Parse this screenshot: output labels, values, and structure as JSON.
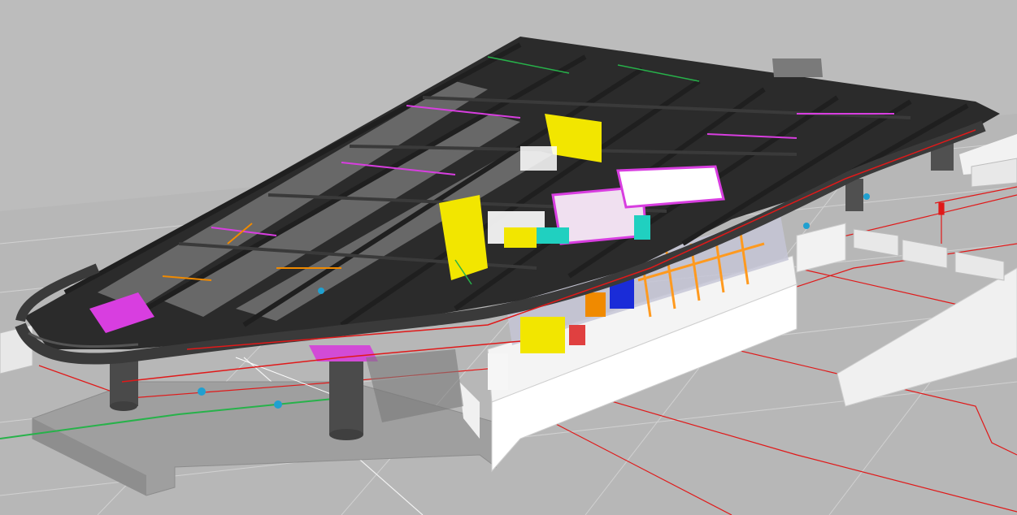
{
  "viewport": {
    "background": "#bdbdbd",
    "icon": "3d-model-viewport-icon"
  },
  "model": {
    "colors": {
      "ground": "#b4b4b4",
      "roof_frame": "#2b2b2b",
      "roof_edge": "#3a3a3a",
      "slab_shadow": "#9c9c9c",
      "column": "#4a4a4a",
      "column_cap": "#d24bd6",
      "duct_red": "#e01919",
      "pipe_green": "#27b24a",
      "service_yellow": "#f2e600",
      "service_magenta": "#d83ee0",
      "service_cyan": "#20d0c0",
      "service_orange": "#f08a00",
      "service_blue": "#1a2cd8",
      "glass_orange": "#ff9a1f",
      "facade_white": "#f4f4f4",
      "fence": "#eaeaea"
    }
  }
}
